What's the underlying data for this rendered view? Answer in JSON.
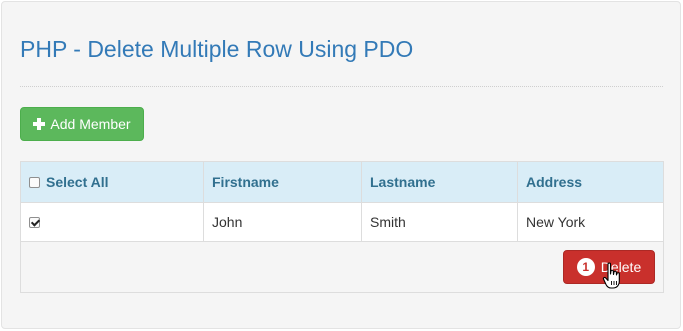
{
  "page": {
    "title": "PHP - Delete Multiple Row Using PDO",
    "add_button_label": "Add Member"
  },
  "table": {
    "columns": [
      "Select All",
      "Firstname",
      "Lastname",
      "Address"
    ],
    "rows": [
      {
        "checked": true,
        "firstname": "John",
        "lastname": "Smith",
        "address": "New York"
      }
    ]
  },
  "delete_button": {
    "badge_count": "1",
    "label": "Delete"
  },
  "colors": {
    "title": "#337ab7",
    "add_button": "#5cb85c",
    "delete_button": "#c9302c",
    "table_header_bg": "#d9edf7",
    "table_header_text": "#31708f"
  },
  "icons": {
    "add": "plus-icon",
    "cursor": "hand-pointer-icon"
  }
}
